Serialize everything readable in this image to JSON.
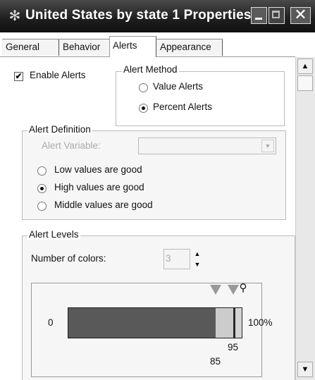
{
  "window": {
    "title": "United States by state 1 Properties",
    "app_icon": "wrench-star-icon"
  },
  "tabs": [
    {
      "label": "General",
      "active": false
    },
    {
      "label": "Behavior",
      "active": false
    },
    {
      "label": "Alerts",
      "active": true
    },
    {
      "label": "Appearance",
      "active": false
    }
  ],
  "alerts": {
    "enable_label": "Enable Alerts",
    "enable_checked": true,
    "method_group": "Alert Method",
    "method_options": [
      {
        "label": "Value Alerts",
        "selected": false
      },
      {
        "label": "Percent Alerts",
        "selected": true
      }
    ]
  },
  "definition": {
    "group": "Alert Definition",
    "variable_label": "Alert Variable:",
    "variable_value": "",
    "options": [
      {
        "label": "Low values are good",
        "selected": false
      },
      {
        "label": "High values are good",
        "selected": true
      },
      {
        "label": "Middle values are good",
        "selected": false
      }
    ]
  },
  "levels": {
    "group": "Alert Levels",
    "num_colors_label": "Number of colors:",
    "num_colors_value": "3",
    "range_min_label": "0",
    "range_max_label": "100%",
    "threshold_1": 85,
    "threshold_2": 95,
    "threshold_1_label": "85",
    "threshold_2_label": "95",
    "segment_colors": [
      "#595959",
      "#cccccc",
      "#2a2a2a"
    ]
  }
}
